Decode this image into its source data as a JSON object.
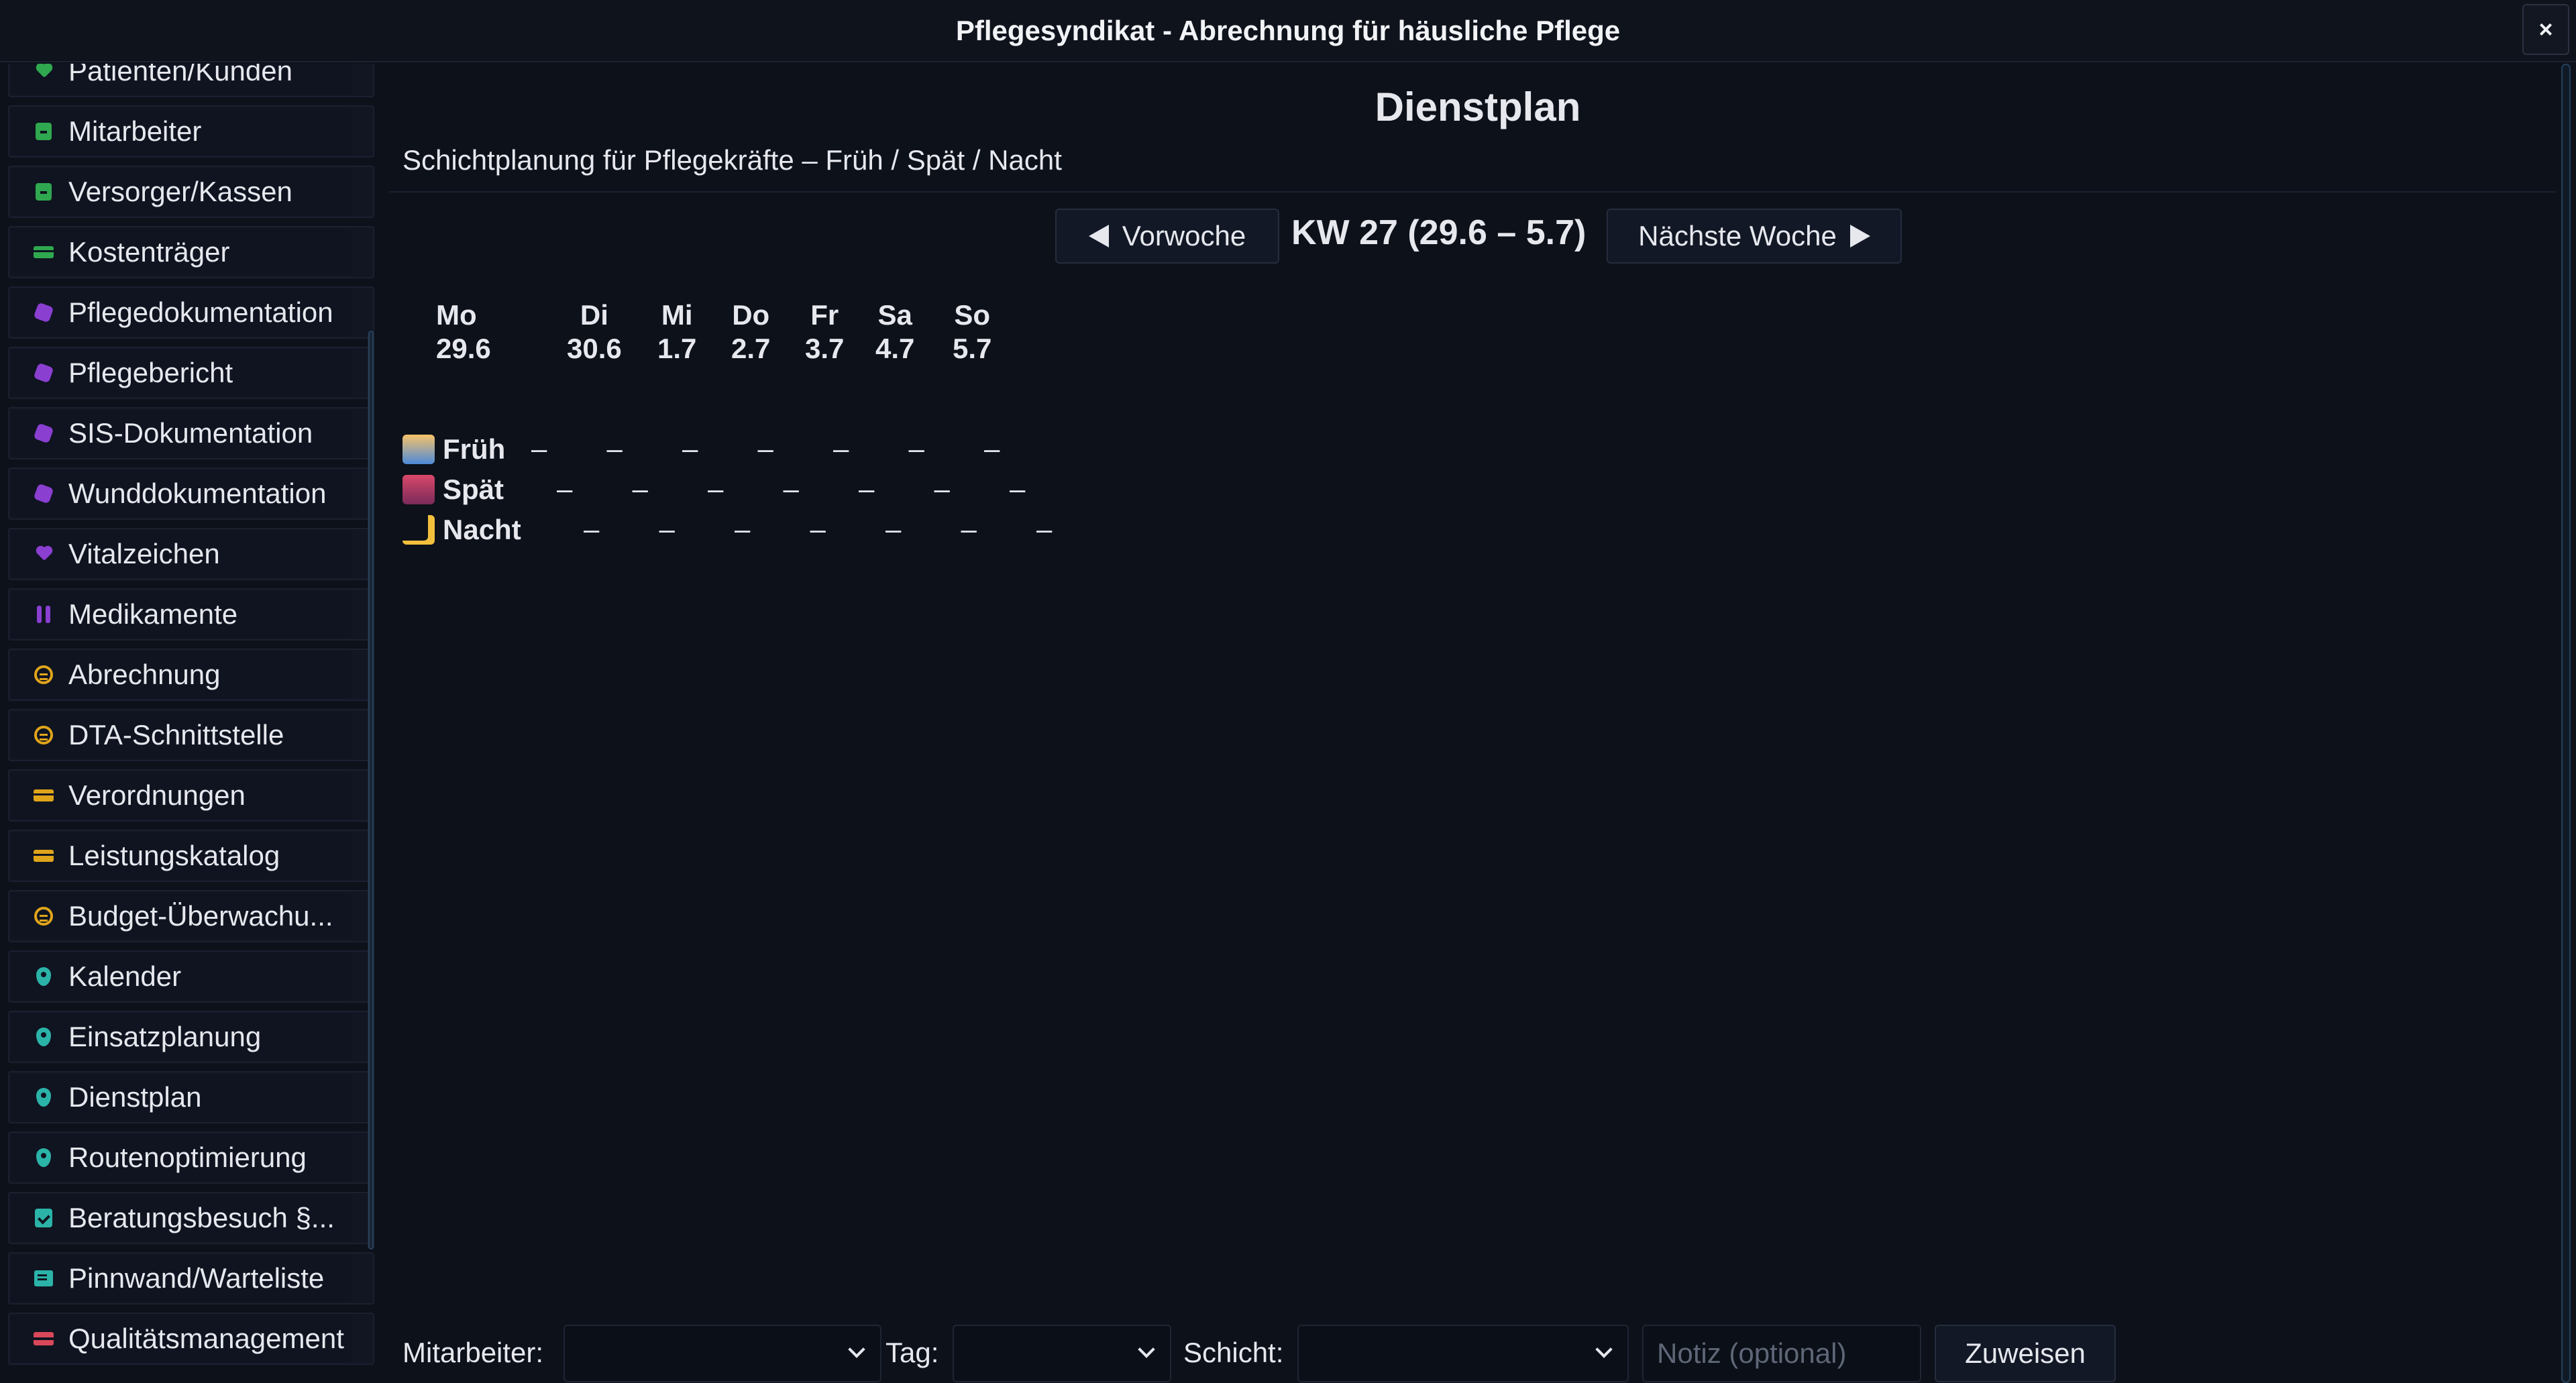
{
  "window": {
    "title": "Pflegesyndikat - Abrechnung für häusliche Pflege",
    "close_label": "×"
  },
  "sidebar": {
    "items": [
      {
        "label": "Patienten/Kunden",
        "icon": "heart-icon",
        "color": "#2fa84f"
      },
      {
        "label": "Mitarbeiter",
        "icon": "user-box-icon",
        "color": "#2fa84f"
      },
      {
        "label": "Versorger/Kassen",
        "icon": "user-box-icon",
        "color": "#2fa84f"
      },
      {
        "label": "Kostenträger",
        "icon": "card-icon",
        "color": "#2fa84f"
      },
      {
        "label": "Pflegedokumentation",
        "icon": "blob-icon",
        "color": "#8a3fd1"
      },
      {
        "label": "Pflegebericht",
        "icon": "blob-icon",
        "color": "#8a3fd1"
      },
      {
        "label": "SIS-Dokumentation",
        "icon": "blob-icon",
        "color": "#8a3fd1"
      },
      {
        "label": "Wunddokumentation",
        "icon": "blob-icon",
        "color": "#8a3fd1"
      },
      {
        "label": "Vitalzeichen",
        "icon": "heart-icon",
        "color": "#8a3fd1"
      },
      {
        "label": "Medikamente",
        "icon": "pill-icon",
        "color": "#8a3fd1"
      },
      {
        "label": "Abrechnung",
        "icon": "coin-icon",
        "color": "#e0a41a"
      },
      {
        "label": "DTA-Schnittstelle",
        "icon": "coin-icon",
        "color": "#e0a41a"
      },
      {
        "label": "Verordnungen",
        "icon": "card-icon",
        "color": "#e0a41a"
      },
      {
        "label": "Leistungskatalog",
        "icon": "card-icon",
        "color": "#e0a41a"
      },
      {
        "label": "Budget-Überwachu...",
        "icon": "coin-icon",
        "color": "#e0a41a"
      },
      {
        "label": "Kalender",
        "icon": "pin-icon",
        "color": "#2bb3a8"
      },
      {
        "label": "Einsatzplanung",
        "icon": "pin-icon",
        "color": "#2bb3a8"
      },
      {
        "label": "Dienstplan",
        "icon": "pin-icon",
        "color": "#2bb3a8"
      },
      {
        "label": "Routenoptimierung",
        "icon": "pin-icon",
        "color": "#2bb3a8"
      },
      {
        "label": "Beratungsbesuch §...",
        "icon": "check-icon",
        "color": "#2bb3a8"
      },
      {
        "label": "Pinnwand/Warteliste",
        "icon": "note-icon",
        "color": "#2bb3a8"
      },
      {
        "label": "Qualitätsmanagement",
        "icon": "stripe-icon",
        "color": "#d9485a"
      }
    ]
  },
  "main": {
    "title": "Dienstplan",
    "subtitle": "Schichtplanung für Pflegekräfte – Früh / Spät / Nacht",
    "prev_week": "Vorwoche",
    "next_week": "Nächste Woche",
    "week_label": "KW 27  (29.6 – 5.7)",
    "days": [
      {
        "name": "Mo",
        "date": "29.6"
      },
      {
        "name": "Di",
        "date": "30.6"
      },
      {
        "name": "Mi",
        "date": "1.7"
      },
      {
        "name": "Do",
        "date": "2.7"
      },
      {
        "name": "Fr",
        "date": "3.7"
      },
      {
        "name": "Sa",
        "date": "4.7"
      },
      {
        "name": "So",
        "date": "5.7"
      }
    ],
    "shifts": [
      {
        "label": "Früh",
        "cells": [
          "–",
          "–",
          "–",
          "–",
          "–",
          "–",
          "–"
        ]
      },
      {
        "label": "Spät",
        "cells": [
          "–",
          "–",
          "–",
          "–",
          "–",
          "–",
          "–"
        ]
      },
      {
        "label": "Nacht",
        "cells": [
          "–",
          "–",
          "–",
          "–",
          "–",
          "–",
          "–"
        ]
      }
    ]
  },
  "form": {
    "employee_label": "Mitarbeiter:",
    "day_label": "Tag:",
    "shift_label": "Schicht:",
    "note_placeholder": "Notiz (optional)",
    "assign_label": "Zuweisen"
  }
}
